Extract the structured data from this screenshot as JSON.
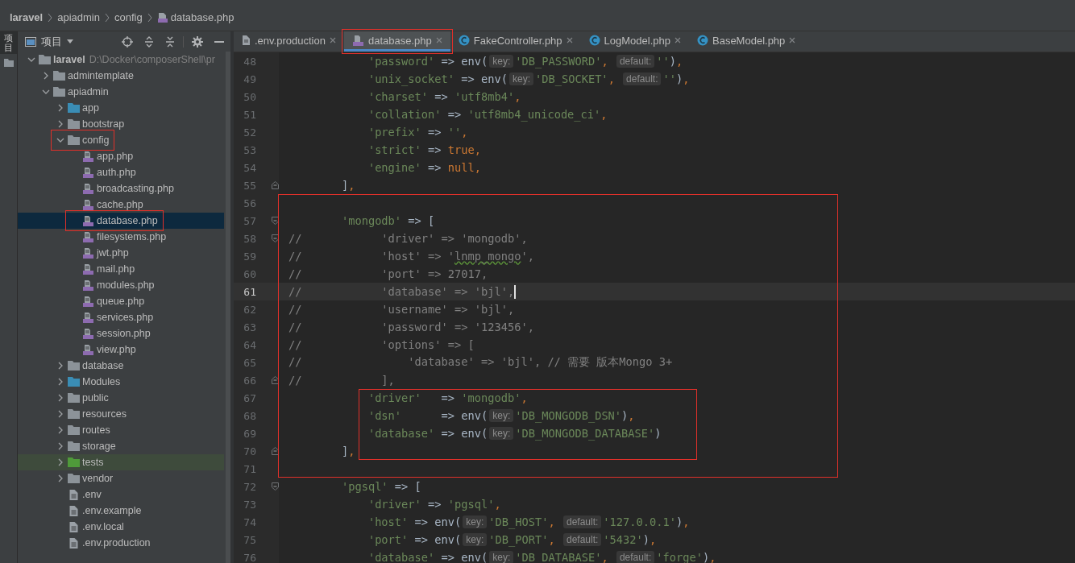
{
  "breadcrumb": [
    {
      "label": "laravel",
      "kind": "folder"
    },
    {
      "label": "apiadmin",
      "kind": "folder"
    },
    {
      "label": "config",
      "kind": "folder"
    },
    {
      "label": "database.php",
      "kind": "php"
    }
  ],
  "left_strip": {
    "label": "项目"
  },
  "project_panel": {
    "title": "项目",
    "tree": [
      {
        "name": "laravel",
        "path": "D:\\Docker\\composerShell\\pr",
        "kind": "folder",
        "color": "#8c9399",
        "expanded": true,
        "selected": false,
        "highlighted": false,
        "outlined": false,
        "children": [
          {
            "name": "admintemplate",
            "kind": "folder",
            "color": "#8c9399",
            "expanded": false,
            "selected": false,
            "highlighted": false,
            "outlined": false
          },
          {
            "name": "apiadmin",
            "kind": "folder",
            "color": "#8c9399",
            "expanded": true,
            "selected": false,
            "highlighted": false,
            "outlined": false,
            "children": [
              {
                "name": "app",
                "kind": "folder",
                "color": "#3a8db5",
                "expanded": false,
                "selected": false,
                "highlighted": false,
                "outlined": false
              },
              {
                "name": "bootstrap",
                "kind": "folder",
                "color": "#8c9399",
                "expanded": false,
                "selected": false,
                "highlighted": false,
                "outlined": false
              },
              {
                "name": "config",
                "kind": "folder",
                "color": "#8c9399",
                "expanded": true,
                "selected": false,
                "highlighted": false,
                "outlined": true,
                "children": [
                  {
                    "name": "app.php",
                    "kind": "php",
                    "selected": false,
                    "highlighted": false,
                    "outlined": false
                  },
                  {
                    "name": "auth.php",
                    "kind": "php",
                    "selected": false,
                    "highlighted": false,
                    "outlined": false
                  },
                  {
                    "name": "broadcasting.php",
                    "kind": "php",
                    "selected": false,
                    "highlighted": false,
                    "outlined": false
                  },
                  {
                    "name": "cache.php",
                    "kind": "php",
                    "selected": false,
                    "highlighted": false,
                    "outlined": false
                  },
                  {
                    "name": "database.php",
                    "kind": "php",
                    "selected": true,
                    "highlighted": false,
                    "outlined": true
                  },
                  {
                    "name": "filesystems.php",
                    "kind": "php",
                    "selected": false,
                    "highlighted": false,
                    "outlined": false
                  },
                  {
                    "name": "jwt.php",
                    "kind": "php",
                    "selected": false,
                    "highlighted": false,
                    "outlined": false
                  },
                  {
                    "name": "mail.php",
                    "kind": "php",
                    "selected": false,
                    "highlighted": false,
                    "outlined": false
                  },
                  {
                    "name": "modules.php",
                    "kind": "php",
                    "selected": false,
                    "highlighted": false,
                    "outlined": false
                  },
                  {
                    "name": "queue.php",
                    "kind": "php",
                    "selected": false,
                    "highlighted": false,
                    "outlined": false
                  },
                  {
                    "name": "services.php",
                    "kind": "php",
                    "selected": false,
                    "highlighted": false,
                    "outlined": false
                  },
                  {
                    "name": "session.php",
                    "kind": "php",
                    "selected": false,
                    "highlighted": false,
                    "outlined": false
                  },
                  {
                    "name": "view.php",
                    "kind": "php",
                    "selected": false,
                    "highlighted": false,
                    "outlined": false
                  }
                ]
              },
              {
                "name": "database",
                "kind": "folder",
                "color": "#8c9399",
                "expanded": false,
                "selected": false,
                "highlighted": false,
                "outlined": false
              },
              {
                "name": "Modules",
                "kind": "folder",
                "color": "#3a8db5",
                "expanded": false,
                "selected": false,
                "highlighted": false,
                "outlined": false
              },
              {
                "name": "public",
                "kind": "folder",
                "color": "#8c9399",
                "expanded": false,
                "selected": false,
                "highlighted": false,
                "outlined": false
              },
              {
                "name": "resources",
                "kind": "folder",
                "color": "#8c9399",
                "expanded": false,
                "selected": false,
                "highlighted": false,
                "outlined": false
              },
              {
                "name": "routes",
                "kind": "folder",
                "color": "#8c9399",
                "expanded": false,
                "selected": false,
                "highlighted": false,
                "outlined": false
              },
              {
                "name": "storage",
                "kind": "folder",
                "color": "#8c9399",
                "expanded": false,
                "selected": false,
                "highlighted": false,
                "outlined": false
              },
              {
                "name": "tests",
                "kind": "folder",
                "color": "#4f9a3a",
                "expanded": false,
                "selected": false,
                "highlighted": true,
                "outlined": false
              },
              {
                "name": "vendor",
                "kind": "folder",
                "color": "#8c9399",
                "expanded": false,
                "selected": false,
                "highlighted": false,
                "outlined": false
              },
              {
                "name": ".env",
                "kind": "file",
                "selected": false,
                "highlighted": false,
                "outlined": false
              },
              {
                "name": ".env.example",
                "kind": "file",
                "selected": false,
                "highlighted": false,
                "outlined": false
              },
              {
                "name": ".env.local",
                "kind": "file",
                "selected": false,
                "highlighted": false,
                "outlined": false
              },
              {
                "name": ".env.production",
                "kind": "file",
                "selected": false,
                "highlighted": false,
                "outlined": false
              }
            ]
          }
        ]
      }
    ]
  },
  "tabs": [
    {
      "label": ".env.production",
      "kind": "file",
      "selected": false,
      "outlined": false
    },
    {
      "label": "database.php",
      "kind": "php",
      "selected": true,
      "outlined": true
    },
    {
      "label": "FakeController.php",
      "kind": "class",
      "selected": false,
      "outlined": false
    },
    {
      "label": "LogModel.php",
      "kind": "class",
      "selected": false,
      "outlined": false
    },
    {
      "label": "BaseModel.php",
      "kind": "class",
      "selected": false,
      "outlined": false
    }
  ],
  "code": {
    "blocks": [
      {
        "kind": "plain",
        "lines": [
          {
            "num": "48",
            "current": false,
            "tokens": [
              {
                "kind": "str",
                "text": "            'password'"
              },
              {
                "kind": "plain",
                "text": " => env("
              },
              {
                "kind": "hint",
                "text": "key:"
              },
              {
                "kind": "str",
                "text": "'DB_PASSWORD'"
              },
              {
                "kind": "punct",
                "text": ", "
              },
              {
                "kind": "hint",
                "text": "default:"
              },
              {
                "kind": "str",
                "text": "''"
              },
              {
                "kind": "plain",
                "text": ")"
              },
              {
                "kind": "punct",
                "text": ","
              }
            ]
          },
          {
            "num": "49",
            "current": false,
            "tokens": [
              {
                "kind": "str",
                "text": "            'unix_socket'"
              },
              {
                "kind": "plain",
                "text": " => env("
              },
              {
                "kind": "hint",
                "text": "key:"
              },
              {
                "kind": "str",
                "text": "'DB_SOCKET'"
              },
              {
                "kind": "punct",
                "text": ", "
              },
              {
                "kind": "hint",
                "text": "default:"
              },
              {
                "kind": "str",
                "text": "''"
              },
              {
                "kind": "plain",
                "text": ")"
              },
              {
                "kind": "punct",
                "text": ","
              }
            ]
          },
          {
            "num": "50",
            "current": false,
            "tokens": [
              {
                "kind": "str",
                "text": "            'charset'"
              },
              {
                "kind": "plain",
                "text": " => "
              },
              {
                "kind": "str",
                "text": "'utf8mb4'"
              },
              {
                "kind": "punct",
                "text": ","
              }
            ]
          },
          {
            "num": "51",
            "current": false,
            "tokens": [
              {
                "kind": "str",
                "text": "            'collation'"
              },
              {
                "kind": "plain",
                "text": " => "
              },
              {
                "kind": "str",
                "text": "'utf8mb4_unicode_ci'"
              },
              {
                "kind": "punct",
                "text": ","
              }
            ]
          },
          {
            "num": "52",
            "current": false,
            "tokens": [
              {
                "kind": "str",
                "text": "            'prefix'"
              },
              {
                "kind": "plain",
                "text": " => "
              },
              {
                "kind": "str",
                "text": "''"
              },
              {
                "kind": "punct",
                "text": ","
              }
            ]
          },
          {
            "num": "53",
            "current": false,
            "tokens": [
              {
                "kind": "str",
                "text": "            'strict'"
              },
              {
                "kind": "plain",
                "text": " => "
              },
              {
                "kind": "keyword",
                "text": "true"
              },
              {
                "kind": "punct",
                "text": ","
              }
            ]
          },
          {
            "num": "54",
            "current": false,
            "tokens": [
              {
                "kind": "str",
                "text": "            'engine'"
              },
              {
                "kind": "plain",
                "text": " => "
              },
              {
                "kind": "keyword",
                "text": "null"
              },
              {
                "kind": "punct",
                "text": ","
              }
            ]
          },
          {
            "num": "55",
            "current": false,
            "kind": "fold-end",
            "tokens": [
              {
                "kind": "plain",
                "text": "        ]"
              },
              {
                "kind": "punct",
                "text": ","
              }
            ]
          }
        ]
      },
      {
        "kind": "frame",
        "blocks": [
          {
            "kind": "plain",
            "lines": [
              {
                "num": "56",
                "current": false
              },
              {
                "num": "57",
                "current": false,
                "kind": "fold-start",
                "tokens": [
                  {
                    "kind": "str",
                    "text": "        'mongodb'"
                  },
                  {
                    "kind": "plain",
                    "text": " => ["
                  }
                ]
              },
              {
                "num": "58",
                "current": false,
                "kind": "fold-start",
                "tokens": [
                  {
                    "kind": "comment",
                    "text": "//            'driver' => 'mongodb',"
                  }
                ]
              },
              {
                "num": "59",
                "current": false,
                "tokens": [
                  {
                    "kind": "comment",
                    "text": "//            'host' => '"
                  },
                  {
                    "kind": "typo",
                    "text": "lnmp_mongo"
                  },
                  {
                    "kind": "comment",
                    "text": "',"
                  }
                ]
              },
              {
                "num": "60",
                "current": false,
                "tokens": [
                  {
                    "kind": "comment",
                    "text": "//            'port' => 27017,"
                  }
                ]
              },
              {
                "num": "61",
                "current": true,
                "tokens": [
                  {
                    "kind": "comment",
                    "text": "//            'database' => 'bjl',"
                  }
                ]
              },
              {
                "num": "62",
                "current": false,
                "tokens": [
                  {
                    "kind": "comment",
                    "text": "//            'username' => 'bjl',"
                  }
                ]
              },
              {
                "num": "63",
                "current": false,
                "tokens": [
                  {
                    "kind": "comment",
                    "text": "//            'password' => '123456',"
                  }
                ]
              },
              {
                "num": "64",
                "current": false,
                "tokens": [
                  {
                    "kind": "comment",
                    "text": "//            'options' => ["
                  }
                ]
              },
              {
                "num": "65",
                "current": false,
                "tokens": [
                  {
                    "kind": "comment",
                    "text": "//                'database' => 'bjl', // 需要 版本Mongo 3+"
                  }
                ]
              },
              {
                "num": "66",
                "current": false,
                "kind": "fold-end",
                "tokens": [
                  {
                    "kind": "comment",
                    "text": "//            ],"
                  }
                ]
              }
            ]
          },
          {
            "kind": "frame",
            "blocks": [
              {
                "kind": "plain",
                "lines": [
                  {
                    "num": "67",
                    "current": false,
                    "tokens": [
                      {
                        "kind": "str",
                        "text": "            'driver'"
                      },
                      {
                        "kind": "plain",
                        "text": "   => "
                      },
                      {
                        "kind": "str",
                        "text": "'mongodb'"
                      },
                      {
                        "kind": "punct",
                        "text": ","
                      }
                    ]
                  },
                  {
                    "num": "68",
                    "current": false,
                    "tokens": [
                      {
                        "kind": "str",
                        "text": "            'dsn'"
                      },
                      {
                        "kind": "plain",
                        "text": "      => env("
                      },
                      {
                        "kind": "hint",
                        "text": "key:"
                      },
                      {
                        "kind": "str",
                        "text": "'DB_MONGODB_DSN'"
                      },
                      {
                        "kind": "plain",
                        "text": ")"
                      },
                      {
                        "kind": "punct",
                        "text": ","
                      }
                    ]
                  },
                  {
                    "num": "69",
                    "current": false,
                    "tokens": [
                      {
                        "kind": "str",
                        "text": "            'database'"
                      },
                      {
                        "kind": "plain",
                        "text": " => env("
                      },
                      {
                        "kind": "hint",
                        "text": "key:"
                      },
                      {
                        "kind": "str",
                        "text": "'DB_MONGODB_DATABASE'"
                      },
                      {
                        "kind": "plain",
                        "text": ")"
                      }
                    ]
                  },
                  {
                    "num": "70",
                    "current": false,
                    "kind": "fold-end",
                    "tokens": [
                      {
                        "kind": "plain",
                        "text": "        ]"
                      },
                      {
                        "kind": "punct",
                        "text": ","
                      }
                    ]
                  }
                ]
              }
            ]
          },
          {
            "kind": "plain",
            "lines": [
              {
                "num": "71",
                "current": false
              }
            ]
          }
        ]
      },
      {
        "kind": "plain",
        "lines": [
          {
            "num": "72",
            "current": false,
            "kind": "fold-start",
            "tokens": [
              {
                "kind": "str",
                "text": "        'pgsql'"
              },
              {
                "kind": "plain",
                "text": " => ["
              }
            ]
          },
          {
            "num": "73",
            "current": false,
            "tokens": [
              {
                "kind": "str",
                "text": "            'driver'"
              },
              {
                "kind": "plain",
                "text": " => "
              },
              {
                "kind": "str",
                "text": "'pgsql'"
              },
              {
                "kind": "punct",
                "text": ","
              }
            ]
          },
          {
            "num": "74",
            "current": false,
            "tokens": [
              {
                "kind": "str",
                "text": "            'host'"
              },
              {
                "kind": "plain",
                "text": " => env("
              },
              {
                "kind": "hint",
                "text": "key:"
              },
              {
                "kind": "str",
                "text": "'DB_HOST'"
              },
              {
                "kind": "punct",
                "text": ", "
              },
              {
                "kind": "hint",
                "text": "default:"
              },
              {
                "kind": "str",
                "text": "'127.0.0.1'"
              },
              {
                "kind": "plain",
                "text": ")"
              },
              {
                "kind": "punct",
                "text": ","
              }
            ]
          },
          {
            "num": "75",
            "current": false,
            "tokens": [
              {
                "kind": "str",
                "text": "            'port'"
              },
              {
                "kind": "plain",
                "text": " => env("
              },
              {
                "kind": "hint",
                "text": "key:"
              },
              {
                "kind": "str",
                "text": "'DB_PORT'"
              },
              {
                "kind": "punct",
                "text": ", "
              },
              {
                "kind": "hint",
                "text": "default:"
              },
              {
                "kind": "str",
                "text": "'5432'"
              },
              {
                "kind": "plain",
                "text": ")"
              },
              {
                "kind": "punct",
                "text": ","
              }
            ]
          },
          {
            "num": "76",
            "current": false,
            "tokens": [
              {
                "kind": "str",
                "text": "            'database'"
              },
              {
                "kind": "plain",
                "text": " => env("
              },
              {
                "kind": "hint",
                "text": "key:"
              },
              {
                "kind": "str",
                "text": "'DB_DATABASE'"
              },
              {
                "kind": "punct",
                "text": ", "
              },
              {
                "kind": "hint",
                "text": "default:"
              },
              {
                "kind": "str",
                "text": "'forge'"
              },
              {
                "kind": "plain",
                "text": ")"
              },
              {
                "kind": "punct",
                "text": ","
              }
            ]
          }
        ]
      }
    ]
  }
}
